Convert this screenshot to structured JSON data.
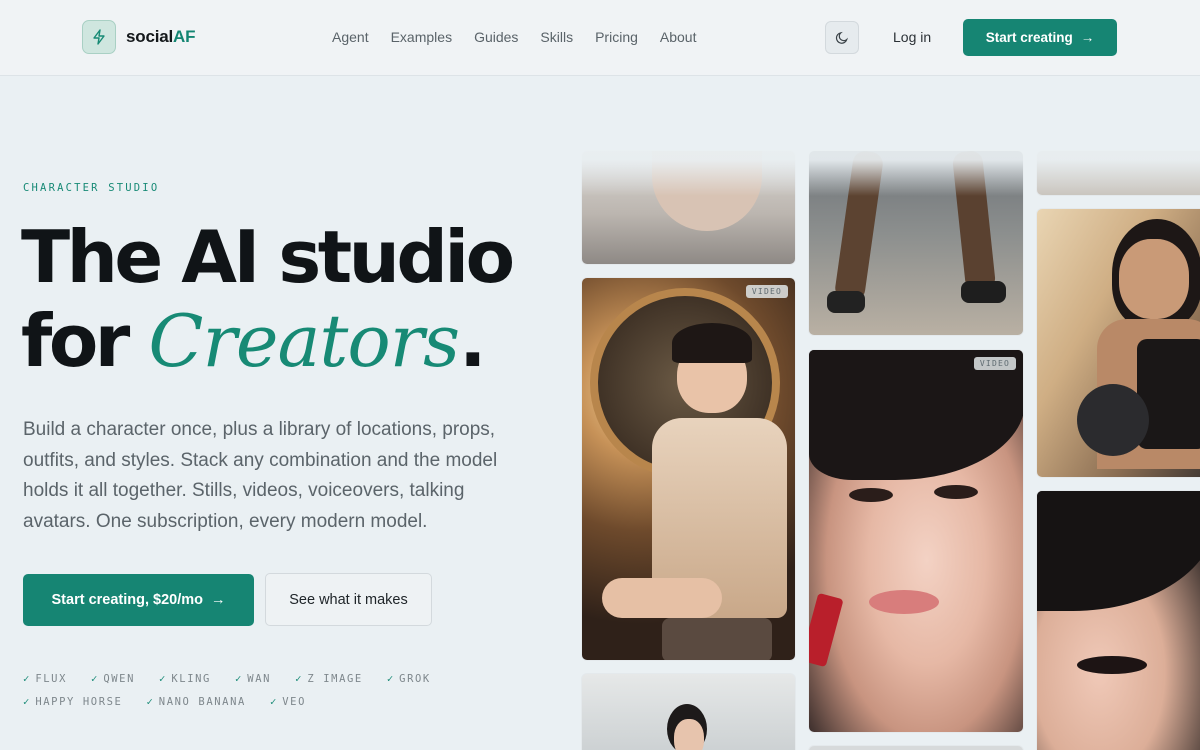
{
  "brand": {
    "prefix": "social",
    "accent": "AF",
    "accent_color": "#138572"
  },
  "nav": {
    "items": [
      "Agent",
      "Examples",
      "Guides",
      "Skills",
      "Pricing",
      "About"
    ]
  },
  "header": {
    "theme_icon": "moon-icon",
    "login_label": "Log in",
    "cta_label": "Start creating",
    "cta_icon": "arrow-right-icon"
  },
  "hero": {
    "eyebrow": "CHARACTER STUDIO",
    "headline_line1": "The AI studio",
    "headline_for": "for ",
    "headline_script": "Creators",
    "headline_period": ".",
    "lead": "Build a character once, plus a library of locations, props, outfits, and styles. Stack any combination and the model holds it all together. Stills, videos, voiceovers, talking avatars. One subscription, every modern model.",
    "primary_cta": "Start creating, $20/mo",
    "secondary_cta": "See what it makes",
    "models": [
      "FLUX",
      "QWEN",
      "KLING",
      "WAN",
      "Z IMAGE",
      "GROK",
      "HAPPY HORSE",
      "NANO BANANA",
      "VEO"
    ]
  },
  "gallery": {
    "badges": [
      "VIDEO",
      "VIDEO"
    ]
  },
  "colors": {
    "brand_green": "#168573",
    "background": "#eaf0f3"
  }
}
